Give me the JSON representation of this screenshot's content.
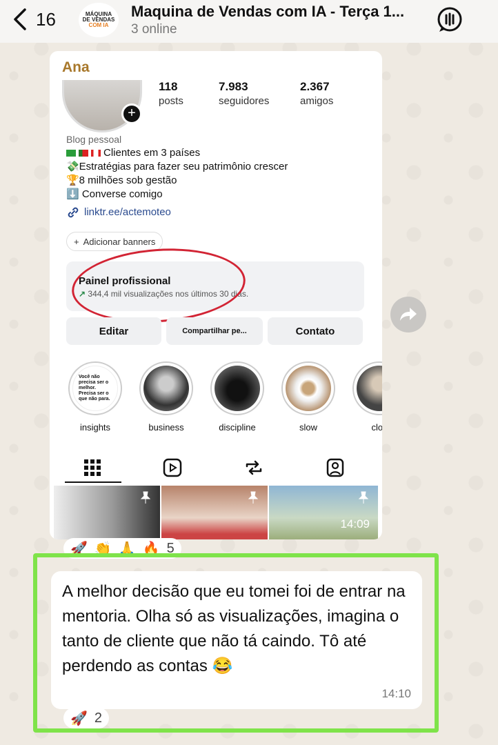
{
  "header": {
    "back_count": "16",
    "group_title": "Maquina de Vendas com IA - Terça 1...",
    "status": "3 online",
    "avatar_lines": [
      "MÁQUINA",
      "DE VENDAS",
      "COM IA"
    ]
  },
  "image_message": {
    "sender": "Ana",
    "time": "14:09",
    "profile": {
      "stats": [
        {
          "num": "118",
          "label": "posts"
        },
        {
          "num": "7.983",
          "label": "seguidores"
        },
        {
          "num": "2.367",
          "label": "amigos"
        }
      ],
      "category": "Blog pessoal",
      "bio_lines": [
        "Clientes em 3 países",
        "💸Estratégias para fazer seu patrimônio crescer",
        "🏆8 milhões sob gestão",
        "⬇️ Converse comigo"
      ],
      "link": "linktr.ee/actemoteo",
      "add_banners": "Adicionar banners",
      "panel_title": "Painel profissional",
      "panel_sub": "344,4 mil visualizações nos últimos 30 dias.",
      "buttons": [
        "Editar",
        "Compartilhar pe...",
        "Contato"
      ],
      "highlights": [
        "insights",
        "business",
        "discipline",
        "slow",
        "clos"
      ],
      "highlight_text": "Você não precisa ser o melhor. Precisa ser o que não para."
    },
    "reactions": [
      "🚀",
      "👏",
      "🙏",
      "🔥"
    ],
    "reaction_count": "5"
  },
  "text_message": {
    "text": "A melhor decisão que eu tomei foi de entrar na mentoria. Olha só as visualizações, imagina o tanto de cliente que não tá caindo. Tô até perdendo as contas 😂",
    "time": "14:10",
    "reaction": "🚀",
    "reaction_count": "2"
  },
  "colors": {
    "highlight_frame": "#7fe34a",
    "sender_name": "#a8782b",
    "annotation_circle": "#d22434"
  }
}
